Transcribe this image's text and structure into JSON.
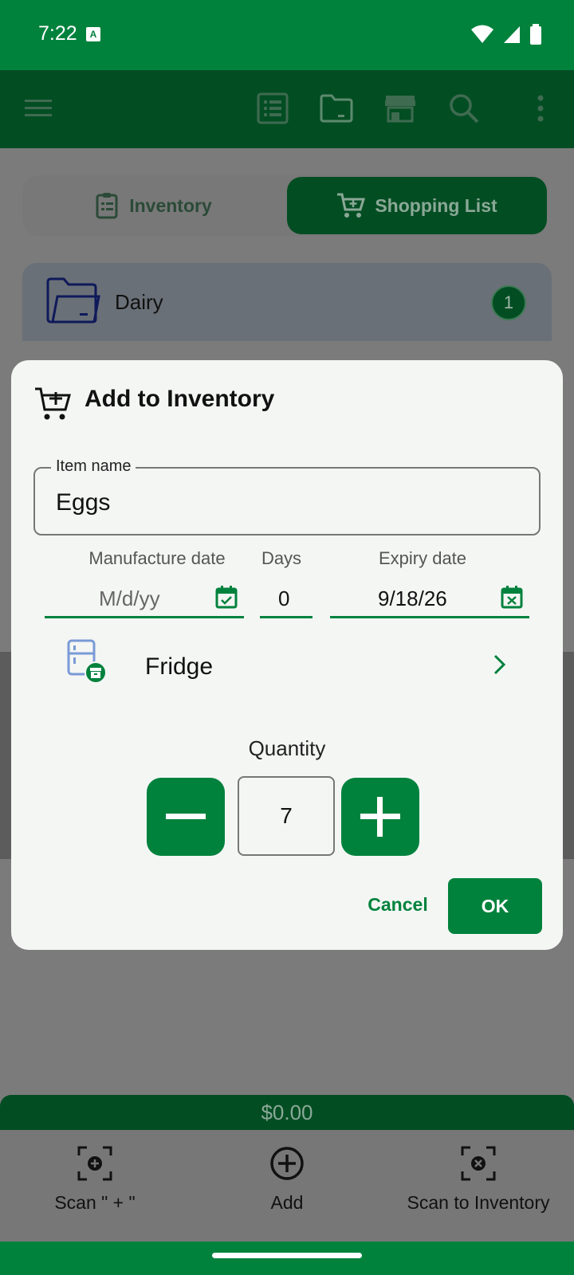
{
  "status_bar": {
    "time": "7:22",
    "notification_letter": "A"
  },
  "tabs": {
    "inventory": "Inventory",
    "shopping_list": "Shopping List"
  },
  "category": {
    "name": "Dairy",
    "count": "1"
  },
  "dialog": {
    "title": "Add to Inventory",
    "item_name_label": "Item name",
    "item_name_value": "Eggs",
    "manufacture_date_label": "Manufacture date",
    "manufacture_date_placeholder": "M/d/yy",
    "days_label": "Days",
    "days_value": "0",
    "expiry_date_label": "Expiry date",
    "expiry_date_value": "9/18/26",
    "location": "Fridge",
    "quantity_label": "Quantity",
    "quantity_value": "7",
    "cancel_label": "Cancel",
    "ok_label": "OK"
  },
  "total": "$0.00",
  "bottom_nav": {
    "scan_plus": "Scan \" + \"",
    "add": "Add",
    "scan_to_inventory": "Scan to Inventory"
  },
  "colors": {
    "primary": "#00823d",
    "dark": "#034d23",
    "dialog_bg": "#f4f6f4"
  }
}
